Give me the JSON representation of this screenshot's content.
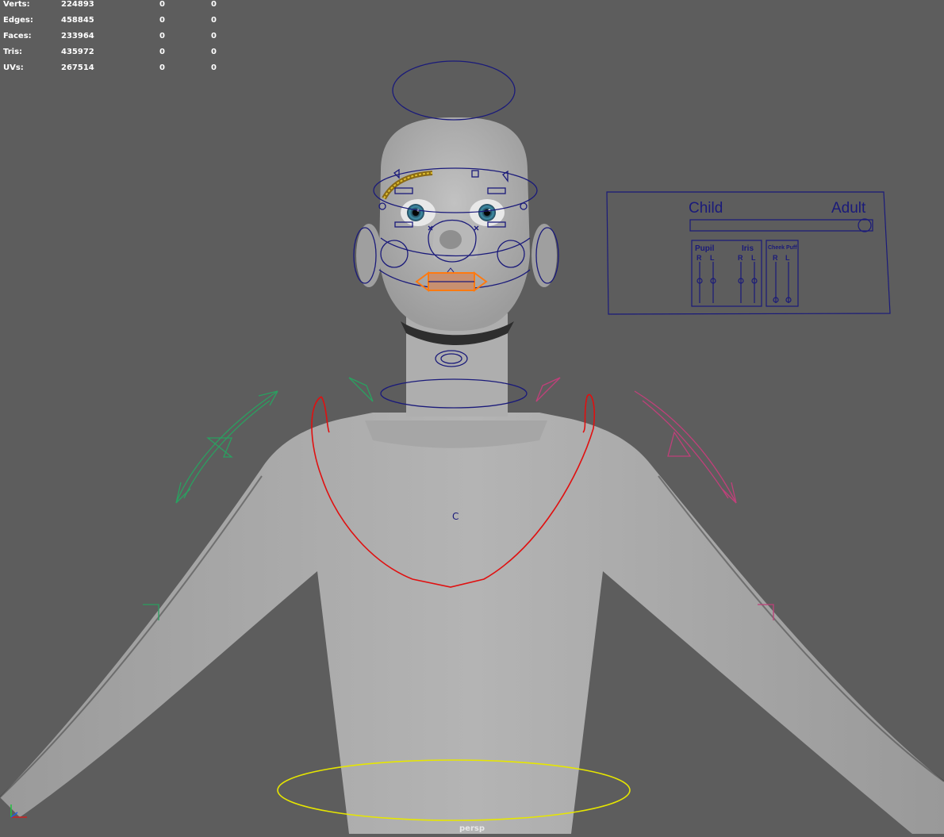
{
  "hud": {
    "rows": [
      {
        "label": "Verts:",
        "v1": "224893",
        "v2": "0",
        "v3": "0"
      },
      {
        "label": "Edges:",
        "v1": "458845",
        "v2": "0",
        "v3": "0"
      },
      {
        "label": "Faces:",
        "v1": "233964",
        "v2": "0",
        "v3": "0"
      },
      {
        "label": "Tris:",
        "v1": "435972",
        "v2": "0",
        "v3": "0"
      },
      {
        "label": "UVs:",
        "v1": "267514",
        "v2": "0",
        "v3": "0"
      }
    ]
  },
  "camera_label": "persp",
  "rig_panel": {
    "child_label": "Child",
    "adult_label": "Adult",
    "pupil_label": "Pupil",
    "iris_label": "Iris",
    "cheek_label": "Cheek Puff",
    "r": "R",
    "l": "L"
  },
  "chest_label": "C",
  "colors": {
    "background": "#5d5d5d",
    "rig_blue": "#1a1a7a",
    "chest_red": "#e01010",
    "root_yellow": "#e6e600",
    "ik_green": "#2aa060",
    "ik_pink": "#c0407a",
    "mouth_orange": "#ff7a10"
  }
}
